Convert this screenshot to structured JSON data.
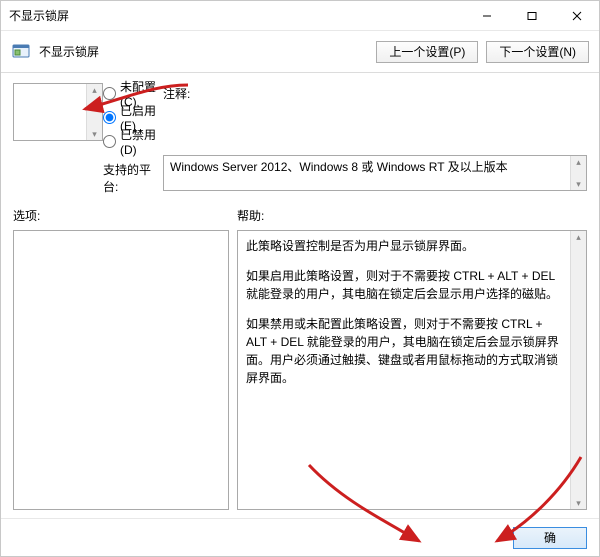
{
  "window": {
    "title": "不显示锁屏"
  },
  "subheader": {
    "title": "不显示锁屏",
    "prev_btn": "上一个设置(P)",
    "next_btn": "下一个设置(N)"
  },
  "radios": {
    "not_configured": "未配置(C)",
    "enabled": "已启用(E)",
    "disabled": "已禁用(D)",
    "selected": "enabled"
  },
  "labels": {
    "comment": "注释:",
    "supported": "支持的平台:",
    "options": "选项:",
    "help": "帮助:"
  },
  "supported_text": "Windows Server 2012、Windows 8 或 Windows RT 及以上版本",
  "help_text": {
    "p1": "此策略设置控制是否为用户显示锁屏界面。",
    "p2": "如果启用此策略设置，则对于不需要按 CTRL + ALT + DEL  就能登录的用户，其电脑在锁定后会显示用户选择的磁贴。",
    "p3": "如果禁用或未配置此策略设置，则对于不需要按 CTRL + ALT + DEL 就能登录的用户，其电脑在锁定后会显示锁屏界面。用户必须通过触摸、键盘或者用鼠标拖动的方式取消锁屏界面。"
  },
  "footer": {
    "ok": "确"
  },
  "colors": {
    "border": "#a9a9a9",
    "accent": "#3a8de0",
    "annotation": "#cc1f1f"
  }
}
